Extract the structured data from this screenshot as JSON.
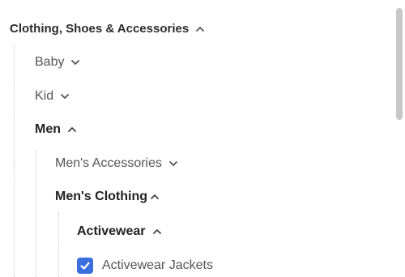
{
  "category_tree": {
    "root": {
      "label": "Clothing, Shoes & Accessories",
      "expanded": true
    },
    "baby": {
      "label": "Baby",
      "expanded": false
    },
    "kid": {
      "label": "Kid",
      "expanded": false
    },
    "men": {
      "label": "Men",
      "expanded": true
    },
    "mens_accessories": {
      "label": "Men's Accessories",
      "expanded": false
    },
    "mens_clothing": {
      "label": "Men's Clothing",
      "expanded": true
    },
    "activewear": {
      "label": "Activewear",
      "expanded": true
    },
    "activewear_jackets": {
      "label": "Activewear Jackets",
      "checked": true
    }
  },
  "colors": {
    "checkbox": "#3a6fe0",
    "scrollbar_thumb": "#c8c8c8"
  }
}
